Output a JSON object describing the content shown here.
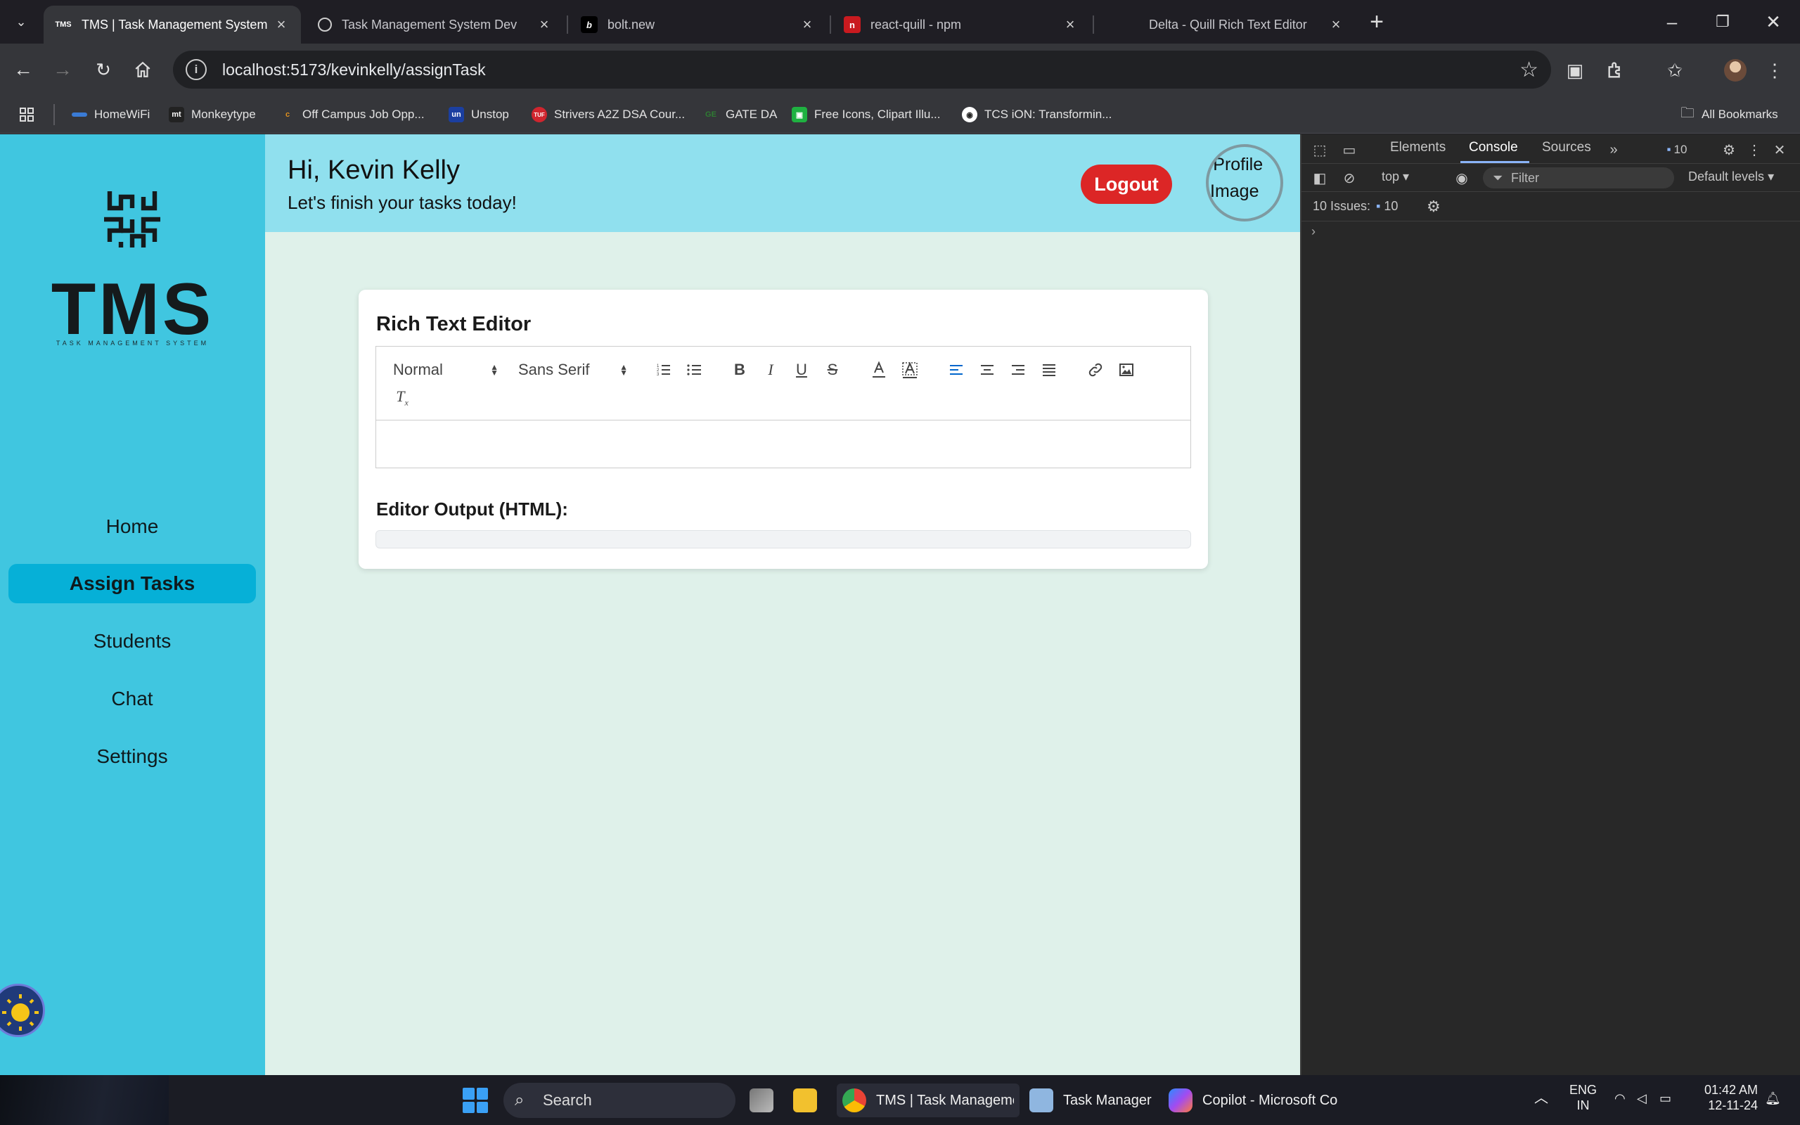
{
  "browser": {
    "tabs": [
      {
        "title": "TMS | Task Management System",
        "icon": "tms-favicon"
      },
      {
        "title": "Task Management System Dev",
        "icon": "openai-icon"
      },
      {
        "title": "bolt.new",
        "icon": "bolt-icon"
      },
      {
        "title": "react-quill - npm",
        "icon": "npm-icon"
      },
      {
        "title": "Delta - Quill Rich Text Editor",
        "icon": "quill-icon"
      }
    ],
    "url": "localhost:5173/kevinkelly/assignTask",
    "bookmarks": [
      {
        "label": "HomeWiFi",
        "icon": "wifi-bookmark-icon",
        "color": "#3a7bd5",
        "glyph": ""
      },
      {
        "label": "Monkeytype",
        "icon": "monkeytype-icon",
        "color": "#222",
        "glyph": "mt"
      },
      {
        "label": "Off Campus Job Opp...",
        "icon": "offcampus-icon",
        "color": "#e0911e",
        "glyph": "c"
      },
      {
        "label": "Unstop",
        "icon": "unstop-icon",
        "color": "#1b3fa0",
        "glyph": "un"
      },
      {
        "label": "Strivers A2Z DSA Cour...",
        "icon": "tuf-icon",
        "color": "#d0252e",
        "glyph": "TUF"
      },
      {
        "label": "GATE DA",
        "icon": "gate-icon",
        "color": "#2e7d32",
        "glyph": "GE"
      },
      {
        "label": "Free Icons, Clipart Illu...",
        "icon": "icons8-icon",
        "color": "#1fb141",
        "glyph": "▣"
      },
      {
        "label": "TCS iON: Transformin...",
        "icon": "tcs-icon",
        "color": "#333",
        "glyph": "◉"
      }
    ],
    "all_bookmarks": "All Bookmarks"
  },
  "app": {
    "logo_text": "TMS",
    "logo_subtitle": "TASK MANAGEMENT SYSTEM",
    "nav": [
      {
        "label": "Home",
        "active": false
      },
      {
        "label": "Assign Tasks",
        "active": true
      },
      {
        "label": "Students",
        "active": false
      },
      {
        "label": "Chat",
        "active": false
      },
      {
        "label": "Settings",
        "active": false
      }
    ],
    "greeting": "Hi, Kevin Kelly",
    "greeting_sub": "Let's finish your tasks today!",
    "logout_label": "Logout",
    "profile_alt": "Profile Image",
    "editor_title": "Rich Text Editor",
    "heading_select": "Normal",
    "font_select": "Sans Serif",
    "output_title": "Editor Output (HTML):",
    "colors": {
      "sidebar": "#40c6e0",
      "header": "#90e0ee",
      "active_nav": "#06b0d7",
      "logout": "#dc2626",
      "page_bg": "#dff1ea"
    }
  },
  "devtools": {
    "tabs": [
      "Elements",
      "Console",
      "Sources"
    ],
    "issue_badge": "10",
    "context": "top",
    "filter_placeholder": "Filter",
    "levels": "Default levels",
    "issues_label": "10 Issues:",
    "issues_count": "10"
  },
  "taskbar": {
    "search_placeholder": "Search",
    "apps": [
      "TMS | Task Manageme",
      "Task Manager",
      "Copilot - Microsoft Co"
    ],
    "lang_top": "ENG",
    "lang_bottom": "IN",
    "time": "01:42 AM",
    "date": "12-11-24"
  }
}
